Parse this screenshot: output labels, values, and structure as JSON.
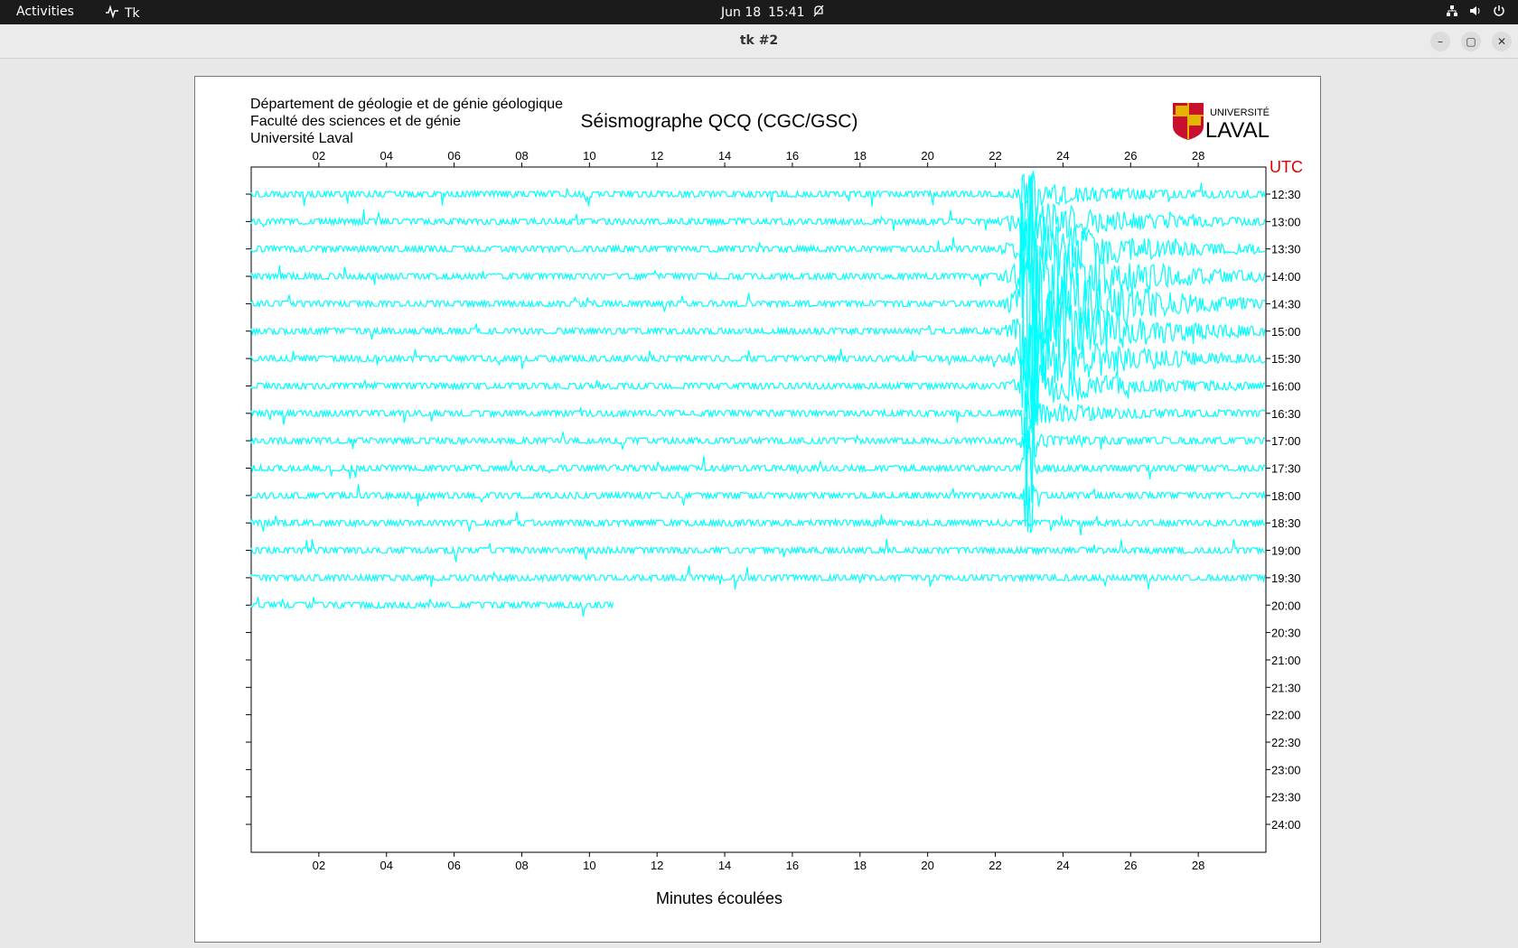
{
  "topbar": {
    "activities": "Activities",
    "app_name": "Tk",
    "date": "Jun 18",
    "time": "15:41"
  },
  "window": {
    "title": "tk #2",
    "minimize": "–",
    "maximize": "▢",
    "close": "✕"
  },
  "header": {
    "dept_line1": "Département de géologie et de génie géologique",
    "dept_line2": "Faculté des sciences et de génie",
    "dept_line3": "Université Laval",
    "title": "Séismographe QCQ (CGC/GSC)",
    "logo_text_small": "UNIVERSITÉ",
    "logo_text_big": "LAVAL"
  },
  "chart_data": {
    "type": "line",
    "x_ticks": [
      "02",
      "04",
      "06",
      "08",
      "10",
      "12",
      "14",
      "16",
      "18",
      "20",
      "22",
      "24",
      "26",
      "28"
    ],
    "x_range": [
      0,
      30
    ],
    "xlabel": "Minutes écoulées",
    "y_unit_label": "UTC",
    "rows": [
      "12:30",
      "13:00",
      "13:30",
      "14:00",
      "14:30",
      "15:00",
      "15:30",
      "16:00",
      "16:30",
      "17:00",
      "17:30",
      "18:00",
      "18:30",
      "19:00",
      "19:30",
      "20:00",
      "20:30",
      "21:00",
      "21:30",
      "22:00",
      "22:30",
      "23:00",
      "23:30",
      "24:00"
    ],
    "trace_color": "#00ffff",
    "active_rows": 16,
    "last_row_end_minute": 10.7,
    "event": {
      "minute": 23.0,
      "peak_row": "14:30"
    }
  }
}
